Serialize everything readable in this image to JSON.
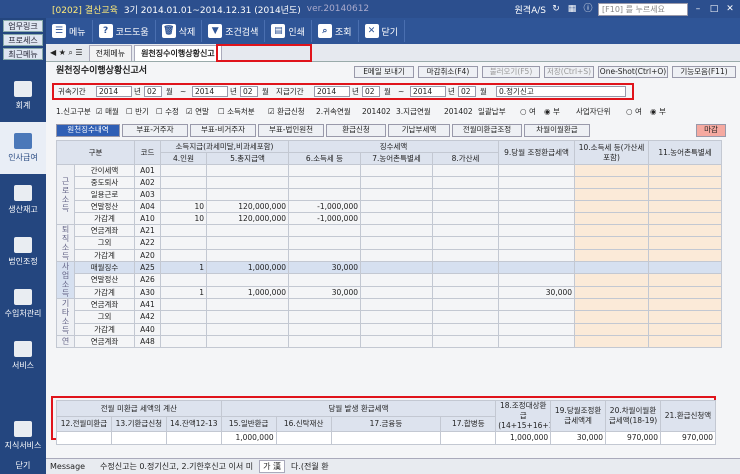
{
  "titlebar": {
    "quick1": "업무링크",
    "quick2": "프로세스",
    "quick3": "최근메뉴",
    "company": "[0202] 결산교육",
    "period": "3기 2014.01.01~2014.12.31 (2014년도)",
    "version": "ver.20140612",
    "right_label": "원격A/S",
    "search_placeholder": "[F10] 를 누르세요"
  },
  "sidebar": {
    "items": [
      {
        "label": "회계"
      },
      {
        "label": "인사급여"
      },
      {
        "label": "생산재고"
      },
      {
        "label": "법인조정"
      },
      {
        "label": "수입처관리"
      },
      {
        "label": "서비스"
      },
      {
        "label": "지식서비스"
      },
      {
        "label": "닫기"
      }
    ]
  },
  "toolbar": {
    "menu": "메뉴",
    "code": "코드도움",
    "del": "삭제",
    "cond": "조건검색",
    "print": "인쇄",
    "view": "조회",
    "close": "닫기"
  },
  "tabs": {
    "t1": "전체메뉴",
    "t2": "원천징수이행상황신고"
  },
  "form": {
    "title": "원천징수이행상황신고서",
    "btn_mail": "E메일 보내기",
    "btn_close": "마감취소(F4)",
    "btn_copy": "불러오기(F5)",
    "btn_save": "저장(Ctrl+S)",
    "btn_oneshot": "One-Shot(Ctrl+O)",
    "btn_func": "기능모음(F11)"
  },
  "period": {
    "attr_label": "귀속기간",
    "a_y1": "2014",
    "a_m1": "02",
    "a_unit": "년",
    "a_mon": "월",
    "tilde": "~",
    "a_y2": "2014",
    "a_m2": "02",
    "pay_label": "지급기간",
    "p_y1": "2014",
    "p_m1": "02",
    "p_y2": "2014",
    "p_m2": "02",
    "type": "0.정기신고"
  },
  "options": {
    "o1": "1.신고구분",
    "o2": "매월",
    "o3": "반기",
    "o4": "수정",
    "o5": "연말",
    "o6": "소득처분",
    "o7": "환급신청",
    "o8": "2.귀속연월",
    "o8v": "201402",
    "o9": "3.지급연월",
    "o9v": "201402",
    "o10": "일괄납부",
    "o11": "여",
    "o12": "부",
    "o13": "사업자단위",
    "o14": "여",
    "o15": "부"
  },
  "subtabs": [
    "원천징수내역",
    "부표-거주자",
    "부표-비거주자",
    "부표-법인원천",
    "환급신청",
    "기납부세액",
    "전월미환급조정",
    "차월이월환급"
  ],
  "close_btn": "마감",
  "grid": {
    "h_gubun": "구분",
    "h_code": "코드",
    "h_income": "소득지급(과세미달,비과세포함)",
    "h_tax": "징수세액",
    "h_c4": "4.인원",
    "h_c5": "5.총지급액",
    "h_c6": "6.소득세 등",
    "h_c7": "7.농어촌특별세",
    "h_c8": "8.가산세",
    "h_c9": "9.당월 조정환급세액",
    "h_c10": "10.소득세 등(가산세 포함)",
    "h_c11": "11.농어촌특별세",
    "groups": {
      "g1": "근로소득",
      "g2": "퇴직소득",
      "g3": "사업소득",
      "g4": "기타소득",
      "g5": "연"
    },
    "rows": [
      {
        "name": "간이세액",
        "code": "A01",
        "n": "",
        "amt": "",
        "tax": "",
        "agri": "",
        "add": "",
        "adj": ""
      },
      {
        "name": "중도퇴사",
        "code": "A02",
        "n": "",
        "amt": "",
        "tax": "",
        "agri": "",
        "add": "",
        "adj": ""
      },
      {
        "name": "일용근로",
        "code": "A03",
        "n": "",
        "amt": "",
        "tax": "",
        "agri": "",
        "add": "",
        "adj": ""
      },
      {
        "name": "연말정산",
        "code": "A04",
        "n": "10",
        "amt": "120,000,000",
        "tax": "-1,000,000",
        "agri": "",
        "add": "",
        "adj": ""
      },
      {
        "name": "가감계",
        "code": "A10",
        "n": "10",
        "amt": "120,000,000",
        "tax": "-1,000,000",
        "agri": "",
        "add": "",
        "adj": ""
      },
      {
        "name": "연금계좌",
        "code": "A21",
        "n": "",
        "amt": "",
        "tax": "",
        "agri": "",
        "add": "",
        "adj": ""
      },
      {
        "name": "그외",
        "code": "A22",
        "n": "",
        "amt": "",
        "tax": "",
        "agri": "",
        "add": "",
        "adj": ""
      },
      {
        "name": "가감계",
        "code": "A20",
        "n": "",
        "amt": "",
        "tax": "",
        "agri": "",
        "add": "",
        "adj": ""
      },
      {
        "name": "매월징수",
        "code": "A25",
        "n": "1",
        "amt": "1,000,000",
        "tax": "30,000",
        "agri": "",
        "add": "",
        "adj": ""
      },
      {
        "name": "연말정산",
        "code": "A26",
        "n": "",
        "amt": "",
        "tax": "",
        "agri": "",
        "add": "",
        "adj": ""
      },
      {
        "name": "가감계",
        "code": "A30",
        "n": "1",
        "amt": "1,000,000",
        "tax": "30,000",
        "agri": "",
        "add": "",
        "adj": "30,000"
      },
      {
        "name": "연금계좌",
        "code": "A41",
        "n": "",
        "amt": "",
        "tax": "",
        "agri": "",
        "add": "",
        "adj": ""
      },
      {
        "name": "그외",
        "code": "A42",
        "n": "",
        "amt": "",
        "tax": "",
        "agri": "",
        "add": "",
        "adj": ""
      },
      {
        "name": "가감계",
        "code": "A40",
        "n": "",
        "amt": "",
        "tax": "",
        "agri": "",
        "add": "",
        "adj": ""
      },
      {
        "name": "연금계좌",
        "code": "A48",
        "n": "",
        "amt": "",
        "tax": "",
        "agri": "",
        "add": "",
        "adj": ""
      }
    ]
  },
  "summary": {
    "h_prev": "전월 미환급 세액의 계산",
    "h_curr": "당월 발생 환급세액",
    "h12": "12.전월미환급",
    "h13": "13.기환급신청",
    "h14": "14.잔액12-13",
    "h15": "15.일반환급",
    "h16": "16.신탁재산",
    "h17a": "17.금융등",
    "h17b": "17.합병등",
    "h18": "18.조정대상환급(14+15+16+17)",
    "h19": "19.당월조정환급세액계",
    "h20": "20.차월이월환급세액(18-19)",
    "h21": "21.환급신청액",
    "v15": "1,000,000",
    "v18": "1,000,000",
    "v19": "30,000",
    "v20": "970,000",
    "v21": "970,000"
  },
  "status": {
    "msg": "Message",
    "text": "수정신고는 0.정기신고, 2.기한후신고 이서 미",
    "ime": "가 漢",
    "tail": "다.(전월 환"
  }
}
